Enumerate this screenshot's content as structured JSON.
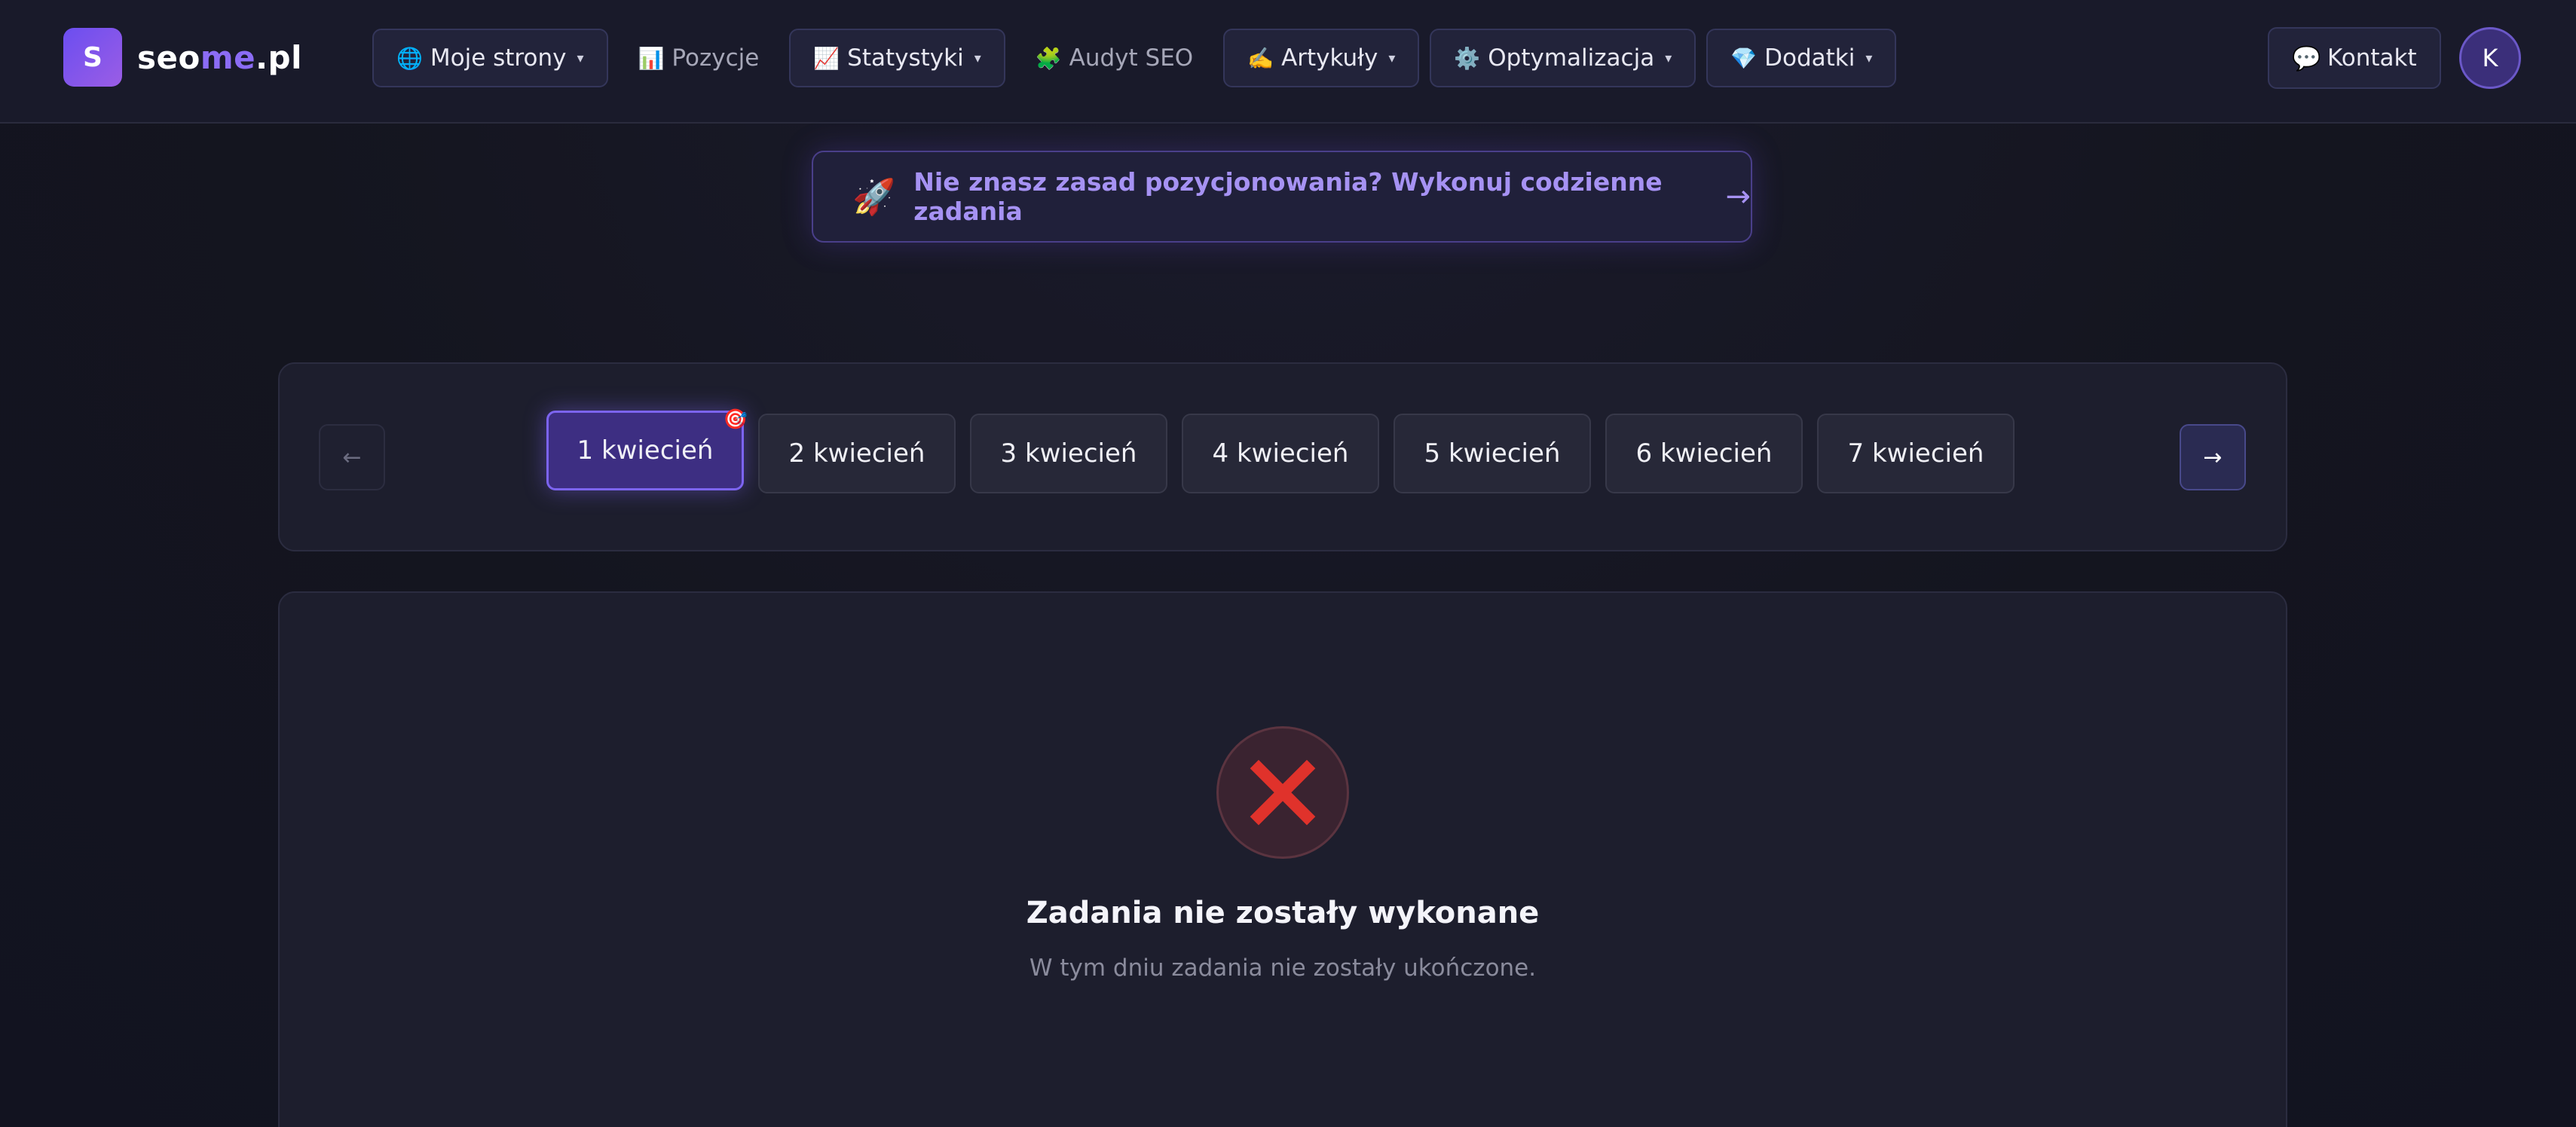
{
  "brand": {
    "mark": "S",
    "name_start": "seo",
    "name_accent": "me",
    "name_end": ".pl"
  },
  "nav": [
    {
      "icon": "🌐",
      "label": "Moje strony",
      "caret": "▾",
      "style": "boxed"
    },
    {
      "icon": "📊",
      "label": "Pozycje",
      "caret": "",
      "style": "plain"
    },
    {
      "icon": "📈",
      "label": "Statystyki",
      "caret": "▾",
      "style": "boxed"
    },
    {
      "icon": "🧩",
      "label": "Audyt SEO",
      "caret": "",
      "style": "plain"
    },
    {
      "icon": "✍️",
      "label": "Artykuły",
      "caret": "▾",
      "style": "boxed"
    },
    {
      "icon": "⚙️",
      "label": "Optymalizacja",
      "caret": "▾",
      "style": "boxed"
    },
    {
      "icon": "💎",
      "label": "Dodatki",
      "caret": "▾",
      "style": "boxed"
    }
  ],
  "header": {
    "contact_icon": "💬",
    "contact_label": "Kontakt",
    "avatar_initial": "K"
  },
  "banner": {
    "icon": "🚀",
    "text": "Nie znasz zasad pozycjonowania? Wykonuj codzienne zadania",
    "arrow": "→"
  },
  "day_picker": {
    "prev_arrow": "←",
    "next_arrow": "→",
    "active_badge": "🎯",
    "days": [
      {
        "label": "1 kwiecień",
        "active": true
      },
      {
        "label": "2 kwiecień",
        "active": false
      },
      {
        "label": "3 kwiecień",
        "active": false
      },
      {
        "label": "4 kwiecień",
        "active": false
      },
      {
        "label": "5 kwiecień",
        "active": false
      },
      {
        "label": "6 kwiecień",
        "active": false
      },
      {
        "label": "7 kwiecień",
        "active": false
      }
    ]
  },
  "status": {
    "icon": "x-mark-icon",
    "icon_color": "#e0322b",
    "title": "Zadania nie zostały wykonane",
    "description": "W tym dniu zadania nie zostały ukończone."
  },
  "colors": {
    "accent": "#8b6cf5",
    "background": "#14151f",
    "panel": "#1d1e2d",
    "error": "#e0322b"
  }
}
